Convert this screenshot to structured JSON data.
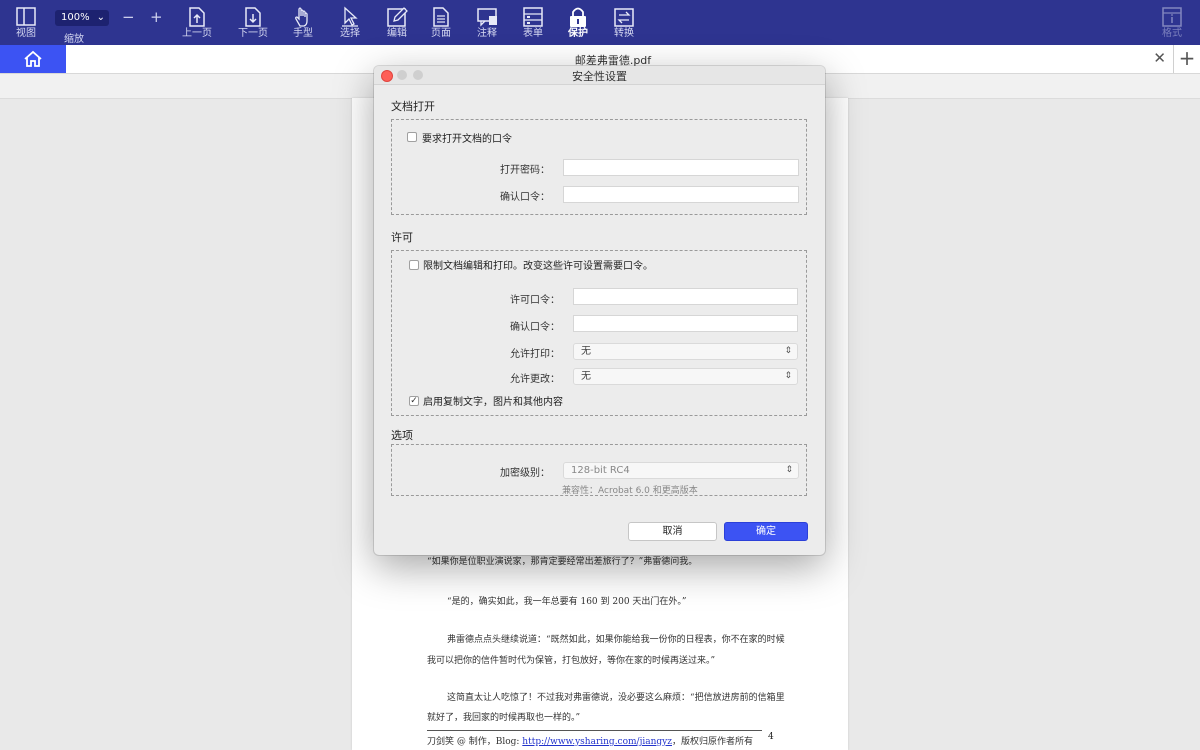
{
  "colors": {
    "toolbar_bg": "#2e3490",
    "accent": "#3c53f3",
    "close_light": "#fe5f57"
  },
  "toolbar": {
    "items": [
      {
        "label": "视图",
        "icon": "view-icon"
      },
      {
        "label": "缩放",
        "icon": "zoom-icon"
      },
      {
        "label": "上一页",
        "icon": "prev-page-icon"
      },
      {
        "label": "下一页",
        "icon": "next-page-icon"
      },
      {
        "label": "手型",
        "icon": "hand-icon"
      },
      {
        "label": "选择",
        "icon": "select-icon"
      },
      {
        "label": "编辑",
        "icon": "edit-icon"
      },
      {
        "label": "页面",
        "icon": "page-icon"
      },
      {
        "label": "注释",
        "icon": "comment-icon"
      },
      {
        "label": "表单",
        "icon": "form-icon"
      },
      {
        "label": "保护",
        "icon": "lock-icon"
      },
      {
        "label": "转换",
        "icon": "convert-icon"
      },
      {
        "label": "格式",
        "icon": "info-icon"
      }
    ],
    "zoom_value": "100%",
    "zoom_minus": "−",
    "zoom_plus": "+"
  },
  "tabs": {
    "doc_title": "邮差弗雷德.pdf",
    "close": "✕",
    "add": "+"
  },
  "dialog": {
    "title": "安全性设置",
    "open_section": {
      "title": "文档打开",
      "checkbox_label": "要求打开文档的口令",
      "open_password_label": "打开密码：",
      "confirm_label": "确认口令："
    },
    "permission_section": {
      "title": "许可",
      "checkbox_label": "限制文档编辑和打印。改变这些许可设置需要口令。",
      "permission_password_label": "许可口令：",
      "confirm_label": "确认口令：",
      "allow_print_label": "允许打印：",
      "allow_print_value": "无",
      "allow_change_label": "允许更改：",
      "allow_change_value": "无",
      "copy_checkbox_mark": "✓",
      "copy_checkbox_label": "启用复制文字，图片和其他内容"
    },
    "options_section": {
      "title": "选项",
      "encryption_label": "加密级别：",
      "encryption_value": "128-bit RC4",
      "compat_text": "兼容性：Acrobat 6.0 和更高版本"
    },
    "cancel_label": "取消",
    "ok_label": "确定"
  },
  "page": {
    "paragraphs": [
      "“如果你是位职业演说家，那肯定要经常出差旅行了？”弗雷德问我。",
      "“是的，确实如此，我一年总要有 160 到 200 天出门在外。”",
      "弗雷德点点头继续说道：“既然如此，如果你能给我一份你的日程表，你不在家的时候",
      "我可以把你的信件暂时代为保管，打包放好，等你在家的时候再送过来。”",
      "这简直太让人吃惊了！不过我对弗雷德说，没必要这么麻烦：“把信放进房前的信箱里",
      "就好了，我回家的时候再取也一样的。”"
    ],
    "footer_prefix": "刀剑笑 @ 制作，Blog: ",
    "footer_link": "http://www.ysharing.com/jiangyz",
    "footer_suffix": "，版权归原作者所有",
    "page_number": "4"
  }
}
